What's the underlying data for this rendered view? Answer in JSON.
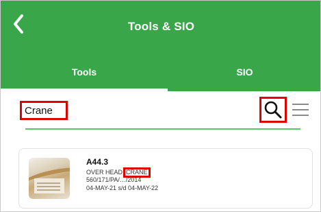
{
  "header": {
    "title": "Tools & SIO"
  },
  "tabs": [
    {
      "label": "Tools",
      "selected": true
    },
    {
      "label": "SIO",
      "selected": false
    }
  ],
  "search": {
    "value": "Crane"
  },
  "results": [
    {
      "code": "A44.3",
      "desc_prefix": "OVER HEAD",
      "desc_highlight": "CRANE",
      "ref": "560/171/PA/…/2014",
      "validity": "04-MAY-21 s/d 04-MAY-22"
    }
  ],
  "colors": {
    "brand_green": "#3aa64a",
    "highlight_red": "#e00000"
  }
}
